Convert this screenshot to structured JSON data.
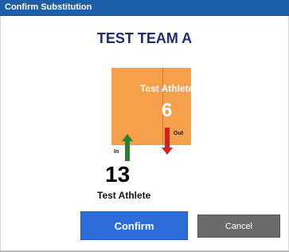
{
  "window": {
    "title": "Confirm Substitution"
  },
  "team": {
    "name": "TEST TEAM A"
  },
  "jersey": {
    "name": "Test Athlete",
    "number": "6",
    "color": "#f6a04b"
  },
  "arrows": {
    "in_label": "In",
    "out_label": "Out",
    "in_color": "#2e7d32",
    "out_color": "#d42020"
  },
  "incoming_player": {
    "number": "13",
    "name": "Test Athlete"
  },
  "buttons": {
    "confirm_label": "Confirm",
    "cancel_label": "Cancel"
  },
  "colors": {
    "titlebar": "#1c5fa8",
    "team_name": "#1f2c74",
    "confirm": "#2d6bd9",
    "cancel": "#6a6a6a"
  }
}
